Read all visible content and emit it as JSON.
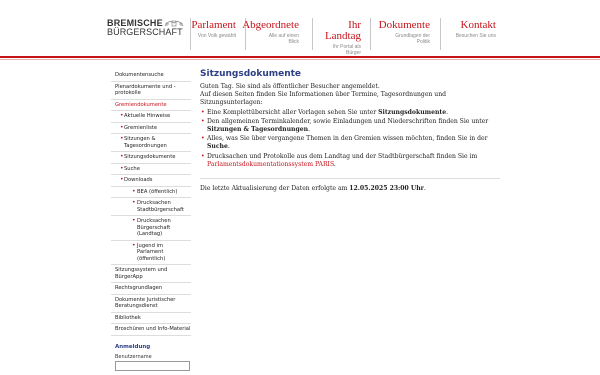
{
  "logo": {
    "line1": "BREMISCHE",
    "line2": "BÜRGERSCHAFT"
  },
  "nav": [
    {
      "title": "Parlament",
      "sub": [
        "Von Volk gewählt"
      ]
    },
    {
      "title": "Abgeordnete",
      "sub": [
        "Alle auf einen",
        "Blick"
      ]
    },
    {
      "title": "Ihr\nLandtag",
      "sub": [
        "Ihr Portal als",
        "Bürger"
      ]
    },
    {
      "title": "Dokumente",
      "sub": [
        "Grundlagen der",
        "Politik"
      ]
    },
    {
      "title": "Kontakt",
      "sub": [
        "Besuchen Sie uns"
      ]
    }
  ],
  "sidebar": {
    "items": [
      {
        "label": "Dokumentensuche"
      },
      {
        "label": "Plenardokumente und -protokolle"
      },
      {
        "label": "Gremiendokumente"
      },
      {
        "label": "Aktuelle Hinweise"
      },
      {
        "label": "Gremienliste"
      },
      {
        "label": "Sitzungen & Tagesordnungen"
      },
      {
        "label": "Sitzungsdokumente"
      },
      {
        "label": "Suche"
      },
      {
        "label": "Downloads"
      },
      {
        "label": "BEA (öffentlich)"
      },
      {
        "label": "Drucksachen Stadtbürgerschaft"
      },
      {
        "label": "Drucksachen Bürgerschaft (Landtag)"
      },
      {
        "label": "Jugend im Parlament (öffentlich)"
      },
      {
        "label": "Sitzungssystem und BürgerApp"
      },
      {
        "label": "Rechtsgrundlagen"
      },
      {
        "label": "Dokumente Juristischer Beratungsdienst"
      },
      {
        "label": "Bibliothek"
      },
      {
        "label": "Broschüren und Info-Material"
      }
    ],
    "login_title": "Anmeldung",
    "username_label": "Benutzername"
  },
  "main": {
    "title": "Sitzungsdokumente",
    "greeting": "Guten Tag. Sie sind als öffentlicher Besucher angemeldet.",
    "intro": "Auf diesen Seiten finden Sie Informationen über Termine, Tagesordnungen und Sitzungsunterlagen:",
    "b1_text": "Eine Komplettübersicht aller Vorlagen sehen Sie unter ",
    "b1_bold": "Sitzungsdokumente",
    "b1_end": ".",
    "b2_text": "Den allgemeinen Terminkalender, sowie Einladungen und Niederschriften finden Sie unter ",
    "b2_bold": "Sitzungen & Tagesordnungen",
    "b2_end": ".",
    "b3_text": "Alles, was Sie über vergangene Themen in den Gremien wissen möchten, finden Sie in der ",
    "b3_bold": "Suche",
    "b3_end": ".",
    "b4_text": "Drucksachen und Protokolle aus dem Landtag und der Stadtbürgerschaft finden Sie im ",
    "b4_link": "Parlamentsdokumentationssystem PARIS",
    "b4_end": ".",
    "update_text": "Die letzte Aktualisierung der Daten erfolgte am ",
    "update_bold": "12.05.2025 23:00 Uhr",
    "update_end": "."
  },
  "colors": {
    "accent": "#c6131b",
    "title": "#2d3f86"
  }
}
